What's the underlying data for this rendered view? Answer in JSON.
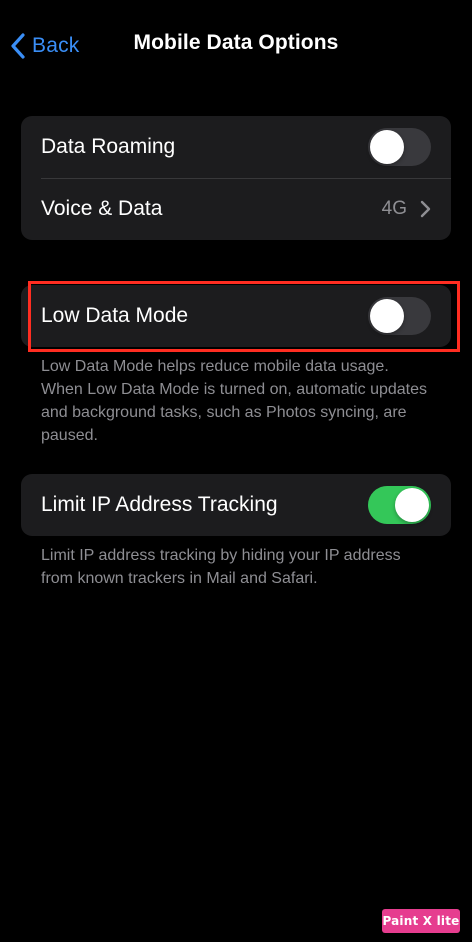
{
  "nav": {
    "back_label": "Back",
    "title": "Mobile Data Options"
  },
  "group1": {
    "data_roaming": {
      "label": "Data Roaming",
      "on": false
    },
    "voice_data": {
      "label": "Voice & Data",
      "value": "4G"
    }
  },
  "group2": {
    "low_data_mode": {
      "label": "Low Data Mode",
      "on": false
    },
    "footer": "Low Data Mode helps reduce mobile data usage. When Low Data Mode is turned on, automatic updates and background tasks, such as Photos syncing, are paused."
  },
  "group3": {
    "limit_ip": {
      "label": "Limit IP Address Tracking",
      "on": true
    },
    "footer": "Limit IP address tracking by hiding your IP address from known trackers in Mail and Safari."
  },
  "watermark": {
    "text": "Paint X lite"
  },
  "colors": {
    "accent": "#3a8ef6",
    "toggle_on": "#34c759",
    "toggle_off": "#39393d",
    "highlight": "#ff2d21",
    "cell": "#1c1c1e"
  }
}
